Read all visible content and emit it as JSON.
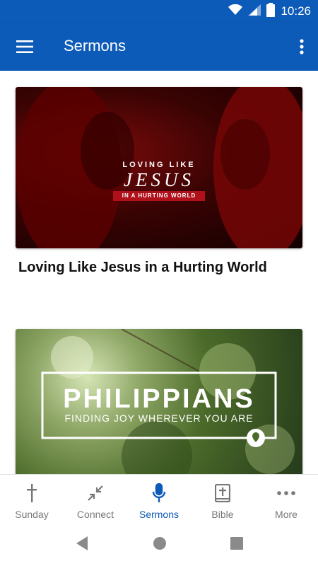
{
  "status_bar": {
    "time": "10:26"
  },
  "app_bar": {
    "title": "Sermons"
  },
  "sermons": [
    {
      "title": "Loving Like Jesus in a Hurting World",
      "image_line1": "LOVING LIKE",
      "image_line2": "JESUS",
      "image_line3": "IN A HURTING WORLD"
    },
    {
      "title": "",
      "image_line1": "PHILIPPIANS",
      "image_line2": "FINDING JOY WHEREVER YOU ARE"
    }
  ],
  "bottom_nav": {
    "items": [
      {
        "label": "Sunday",
        "icon": "cross-icon"
      },
      {
        "label": "Connect",
        "icon": "collapse-arrows-icon"
      },
      {
        "label": "Sermons",
        "icon": "microphone-icon"
      },
      {
        "label": "Bible",
        "icon": "bible-icon"
      },
      {
        "label": "More",
        "icon": "more-dots-icon"
      }
    ],
    "active": "Sermons"
  },
  "colors": {
    "primary": "#0d5bb8",
    "inactive": "#777777"
  }
}
